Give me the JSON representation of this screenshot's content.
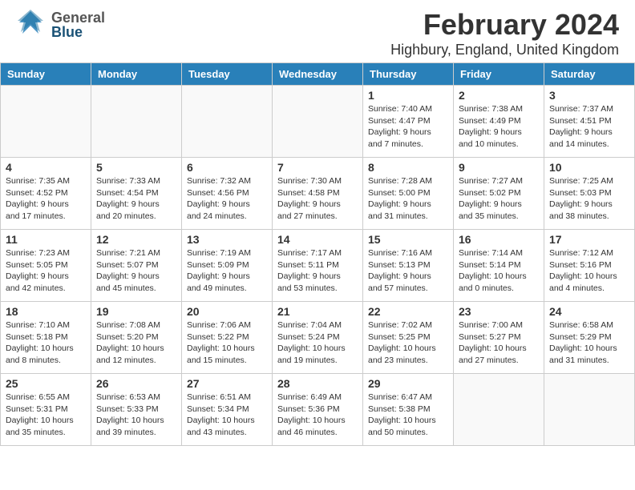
{
  "header": {
    "logo_general": "General",
    "logo_blue": "Blue",
    "title": "February 2024",
    "subtitle": "Highbury, England, United Kingdom"
  },
  "weekdays": [
    "Sunday",
    "Monday",
    "Tuesday",
    "Wednesday",
    "Thursday",
    "Friday",
    "Saturday"
  ],
  "weeks": [
    [
      {
        "num": "",
        "info": ""
      },
      {
        "num": "",
        "info": ""
      },
      {
        "num": "",
        "info": ""
      },
      {
        "num": "",
        "info": ""
      },
      {
        "num": "1",
        "info": "Sunrise: 7:40 AM\nSunset: 4:47 PM\nDaylight: 9 hours\nand 7 minutes."
      },
      {
        "num": "2",
        "info": "Sunrise: 7:38 AM\nSunset: 4:49 PM\nDaylight: 9 hours\nand 10 minutes."
      },
      {
        "num": "3",
        "info": "Sunrise: 7:37 AM\nSunset: 4:51 PM\nDaylight: 9 hours\nand 14 minutes."
      }
    ],
    [
      {
        "num": "4",
        "info": "Sunrise: 7:35 AM\nSunset: 4:52 PM\nDaylight: 9 hours\nand 17 minutes."
      },
      {
        "num": "5",
        "info": "Sunrise: 7:33 AM\nSunset: 4:54 PM\nDaylight: 9 hours\nand 20 minutes."
      },
      {
        "num": "6",
        "info": "Sunrise: 7:32 AM\nSunset: 4:56 PM\nDaylight: 9 hours\nand 24 minutes."
      },
      {
        "num": "7",
        "info": "Sunrise: 7:30 AM\nSunset: 4:58 PM\nDaylight: 9 hours\nand 27 minutes."
      },
      {
        "num": "8",
        "info": "Sunrise: 7:28 AM\nSunset: 5:00 PM\nDaylight: 9 hours\nand 31 minutes."
      },
      {
        "num": "9",
        "info": "Sunrise: 7:27 AM\nSunset: 5:02 PM\nDaylight: 9 hours\nand 35 minutes."
      },
      {
        "num": "10",
        "info": "Sunrise: 7:25 AM\nSunset: 5:03 PM\nDaylight: 9 hours\nand 38 minutes."
      }
    ],
    [
      {
        "num": "11",
        "info": "Sunrise: 7:23 AM\nSunset: 5:05 PM\nDaylight: 9 hours\nand 42 minutes."
      },
      {
        "num": "12",
        "info": "Sunrise: 7:21 AM\nSunset: 5:07 PM\nDaylight: 9 hours\nand 45 minutes."
      },
      {
        "num": "13",
        "info": "Sunrise: 7:19 AM\nSunset: 5:09 PM\nDaylight: 9 hours\nand 49 minutes."
      },
      {
        "num": "14",
        "info": "Sunrise: 7:17 AM\nSunset: 5:11 PM\nDaylight: 9 hours\nand 53 minutes."
      },
      {
        "num": "15",
        "info": "Sunrise: 7:16 AM\nSunset: 5:13 PM\nDaylight: 9 hours\nand 57 minutes."
      },
      {
        "num": "16",
        "info": "Sunrise: 7:14 AM\nSunset: 5:14 PM\nDaylight: 10 hours\nand 0 minutes."
      },
      {
        "num": "17",
        "info": "Sunrise: 7:12 AM\nSunset: 5:16 PM\nDaylight: 10 hours\nand 4 minutes."
      }
    ],
    [
      {
        "num": "18",
        "info": "Sunrise: 7:10 AM\nSunset: 5:18 PM\nDaylight: 10 hours\nand 8 minutes."
      },
      {
        "num": "19",
        "info": "Sunrise: 7:08 AM\nSunset: 5:20 PM\nDaylight: 10 hours\nand 12 minutes."
      },
      {
        "num": "20",
        "info": "Sunrise: 7:06 AM\nSunset: 5:22 PM\nDaylight: 10 hours\nand 15 minutes."
      },
      {
        "num": "21",
        "info": "Sunrise: 7:04 AM\nSunset: 5:24 PM\nDaylight: 10 hours\nand 19 minutes."
      },
      {
        "num": "22",
        "info": "Sunrise: 7:02 AM\nSunset: 5:25 PM\nDaylight: 10 hours\nand 23 minutes."
      },
      {
        "num": "23",
        "info": "Sunrise: 7:00 AM\nSunset: 5:27 PM\nDaylight: 10 hours\nand 27 minutes."
      },
      {
        "num": "24",
        "info": "Sunrise: 6:58 AM\nSunset: 5:29 PM\nDaylight: 10 hours\nand 31 minutes."
      }
    ],
    [
      {
        "num": "25",
        "info": "Sunrise: 6:55 AM\nSunset: 5:31 PM\nDaylight: 10 hours\nand 35 minutes."
      },
      {
        "num": "26",
        "info": "Sunrise: 6:53 AM\nSunset: 5:33 PM\nDaylight: 10 hours\nand 39 minutes."
      },
      {
        "num": "27",
        "info": "Sunrise: 6:51 AM\nSunset: 5:34 PM\nDaylight: 10 hours\nand 43 minutes."
      },
      {
        "num": "28",
        "info": "Sunrise: 6:49 AM\nSunset: 5:36 PM\nDaylight: 10 hours\nand 46 minutes."
      },
      {
        "num": "29",
        "info": "Sunrise: 6:47 AM\nSunset: 5:38 PM\nDaylight: 10 hours\nand 50 minutes."
      },
      {
        "num": "",
        "info": ""
      },
      {
        "num": "",
        "info": ""
      }
    ]
  ]
}
